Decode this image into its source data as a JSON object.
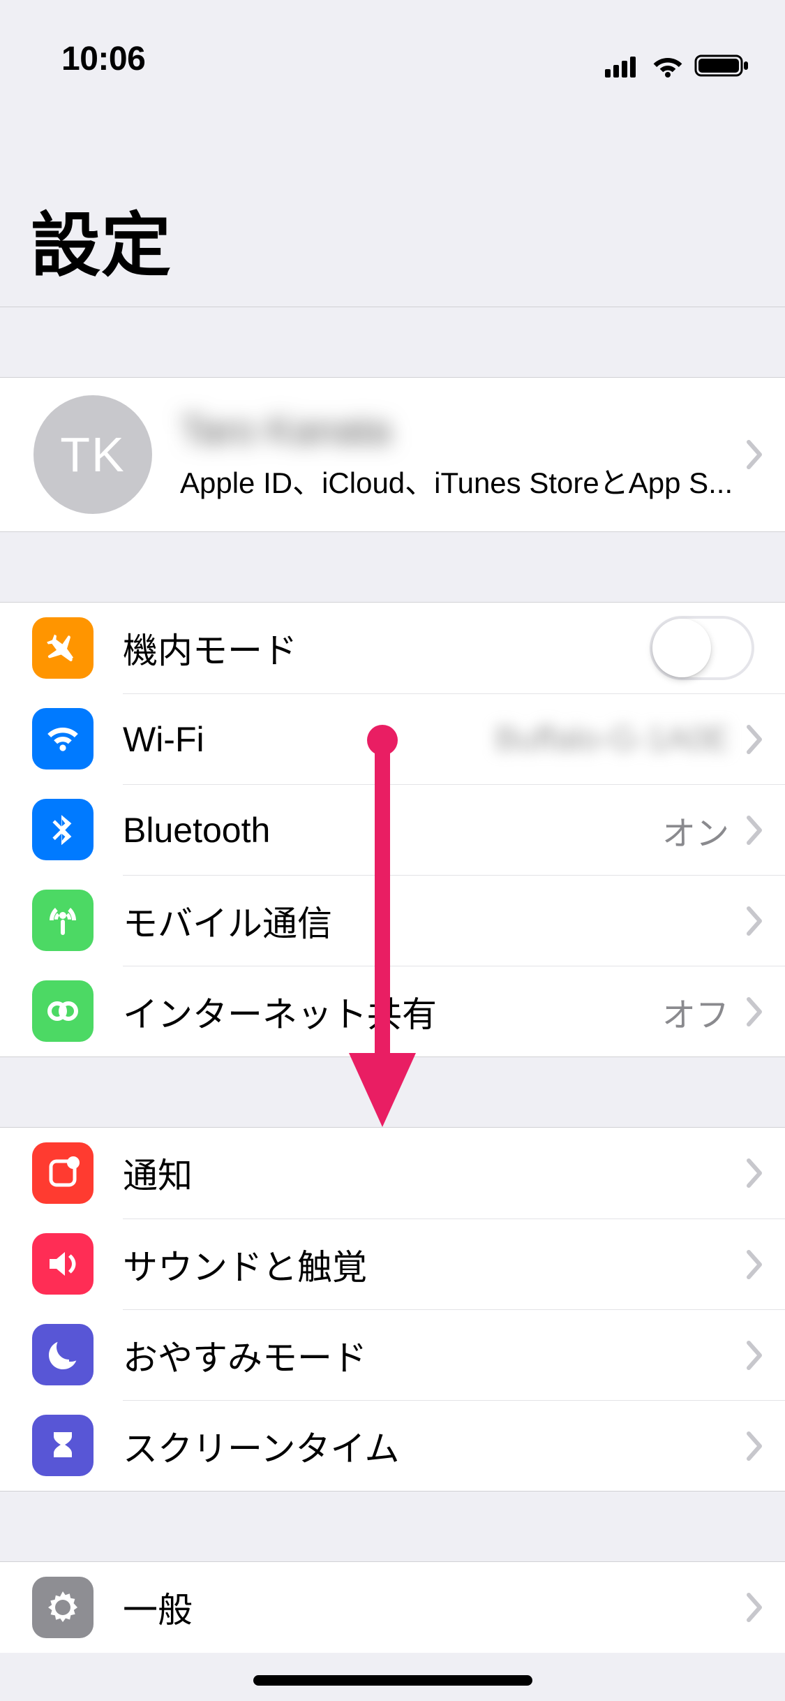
{
  "status_bar": {
    "time": "10:06"
  },
  "header": {
    "title": "設定"
  },
  "profile": {
    "initials": "TK",
    "name": "Taro Kanata",
    "subtitle": "Apple ID、iCloud、iTunes StoreとApp S..."
  },
  "group_connectivity": {
    "airplane": {
      "label": "機内モード"
    },
    "wifi": {
      "label": "Wi-Fi",
      "value": "Buffalo-G-1A0E"
    },
    "bluetooth": {
      "label": "Bluetooth",
      "value": "オン"
    },
    "cellular": {
      "label": "モバイル通信"
    },
    "hotspot": {
      "label": "インターネット共有",
      "value": "オフ"
    }
  },
  "group_notifications": {
    "notifications": {
      "label": "通知"
    },
    "sounds": {
      "label": "サウンドと触覚"
    },
    "dnd": {
      "label": "おやすみモード"
    },
    "screentime": {
      "label": "スクリーンタイム"
    }
  },
  "group_general": {
    "general": {
      "label": "一般"
    }
  }
}
